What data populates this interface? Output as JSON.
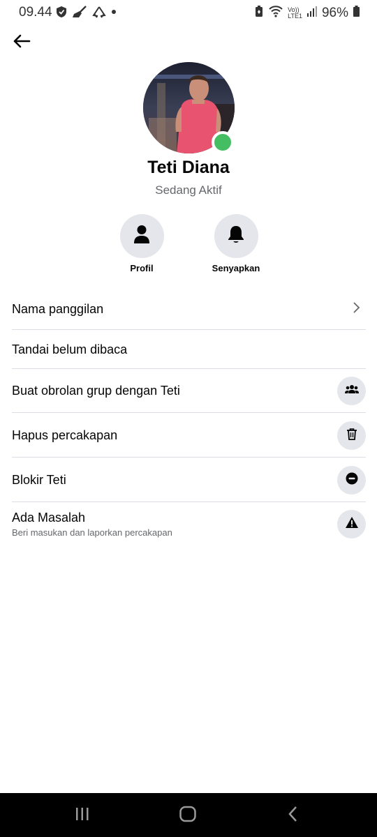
{
  "status_bar": {
    "time": "09.44",
    "battery": "96%",
    "network_label": "LTE1",
    "volte_label": "Vo))",
    "icons": [
      "shield-icon",
      "broom-icon",
      "recycle-icon",
      "dot-icon",
      "battery-saver-icon",
      "wifi-icon",
      "signal-icon",
      "battery-icon"
    ]
  },
  "header": {
    "back_icon": "arrow-left-icon"
  },
  "contact": {
    "name": "Teti Diana",
    "status": "Sedang Aktif",
    "online_color": "#45bd62"
  },
  "quick_actions": [
    {
      "label": "Profil",
      "icon": "person-icon"
    },
    {
      "label": "Senyapkan",
      "icon": "bell-icon"
    }
  ],
  "menu": {
    "items": [
      {
        "label": "Nama panggilan",
        "icon": "chevron-right-icon"
      },
      {
        "label": "Tandai belum dibaca"
      },
      {
        "label": "Buat obrolan grup dengan Teti",
        "icon": "group-icon"
      },
      {
        "label": "Hapus percakapan",
        "icon": "trash-icon"
      },
      {
        "label": "Blokir Teti",
        "icon": "block-icon"
      },
      {
        "label": "Ada Masalah",
        "sublabel": "Beri masukan dan laporkan percakapan",
        "icon": "warning-icon"
      }
    ]
  },
  "nav_bar": {
    "buttons": [
      "recent-apps-icon",
      "home-icon",
      "back-icon"
    ]
  }
}
